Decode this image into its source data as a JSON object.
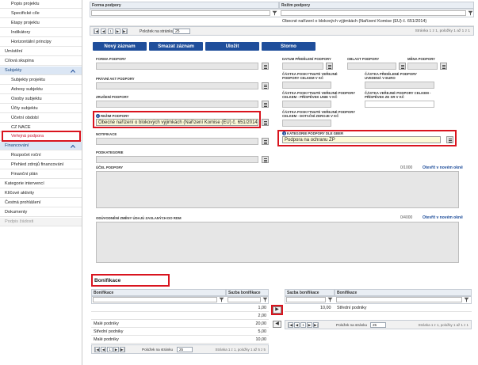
{
  "sidebar": {
    "items": [
      {
        "label": "Popis projektu",
        "level": 2
      },
      {
        "label": "Specifické cíle",
        "level": 2
      },
      {
        "label": "Etapy projektu",
        "level": 2
      },
      {
        "label": "Indikátory",
        "level": 2
      },
      {
        "label": "Horizontální principy",
        "level": 2
      },
      {
        "label": "Umístění",
        "level": 1
      },
      {
        "label": "Cílová skupina",
        "level": 1
      },
      {
        "label": "Subjekty",
        "level": 1
      },
      {
        "label": "Subjekty projektu",
        "level": 2
      },
      {
        "label": "Adresy subjektu",
        "level": 2
      },
      {
        "label": "Osoby subjektu",
        "level": 2
      },
      {
        "label": "Účty subjektu",
        "level": 2
      },
      {
        "label": "Účetní období",
        "level": 2
      },
      {
        "label": "CZ NACE",
        "level": 2
      },
      {
        "label": "Veřejná podpora",
        "level": 2
      },
      {
        "label": "Financování",
        "level": 1
      },
      {
        "label": "Rozpočet roční",
        "level": 2
      },
      {
        "label": "Přehled zdrojů financování",
        "level": 2
      },
      {
        "label": "Finanční plán",
        "level": 2
      },
      {
        "label": "Kategorie intervencí",
        "level": 1
      },
      {
        "label": "Klíčové aktivity",
        "level": 1
      },
      {
        "label": "Čestná prohlášení",
        "level": 1
      },
      {
        "label": "Dokumenty",
        "level": 1
      },
      {
        "label": "Podpis žádosti",
        "level": 1
      }
    ]
  },
  "top_grid": {
    "col1": "Forma podpory",
    "col2": "Režim podpory",
    "row_value": "Obecné nařízení o blokových výjimkách (Nařízení Komise (EU) č. 651/2014)",
    "pager": {
      "first": "|◀",
      "prev": "◀",
      "page": "1",
      "next": "▶",
      "last": "▶|",
      "per_page_label": "Položek na stránku",
      "per_page_value": "25",
      "info": "Stránka 1 z 1, položky 1 až 1 z 1"
    }
  },
  "actions": {
    "new": "Nový záznam",
    "delete": "Smazat záznam",
    "save": "Uložit",
    "cancel": "Storno"
  },
  "form": {
    "forma_podpory": "FORMA PODPORY",
    "pravni_akt": "PRÁVNÍ AKT PODPORY",
    "zruseni": "ZRUŠENÍ PODPORY",
    "rezim_label": "REŽIM PODPORY",
    "rezim_value": "Obecné nařízení o blokových výjimkách (Nařízení Komise (EU) č. 651/2014)",
    "notifikace": "NOTIFIKACE",
    "podkategorie": "PODKATEGORIE",
    "datum": "DATUM PŘIDĚLENÍ PODPORY",
    "oblast": "OBLAST PODPORY",
    "mena": "MĚNA PODPORY",
    "castka_kc": "ČÁSTKA POSKYTNUTÉ VEŘEJNÉ PODPORY CELKEM V KČ",
    "castka_eur": "ČÁSTKA PŘIDĚLENÉ PODPORY UVEDENÁ V EURO",
    "castka_eu": "ČÁSTKA POSKYTNUTÉ VEŘEJNÉ PODPORY CELKEM - PŘÍSPĚVEK UNIE V KČ",
    "castka_sr": "ČÁSTKA VEŘEJNÉ PODPORY CELKEM - PŘÍSPĚVEK ZE SR V KČ",
    "castka_nar": "ČÁSTKA POSKYTNUTÉ VEŘEJNÉ PODPORY CELKEM - DOTAČNÍ ZDROJE V KČ",
    "kategorie_label": "KATEGORIE PODPORY DLE GBER",
    "kategorie_value": "Podpora na ochranu ŽP",
    "ucel": "ÚČEL PODPORY",
    "ucel_counter": "0/1000",
    "ucel_link": "Otevřít v novém okně",
    "oduvodneni": "ODŮVODNĚNÍ ZMĚNY ÚDAJŮ ZASLANÝCH DO RDM",
    "oduvodneni_counter": "0/4000",
    "oduvodneni_link": "Otevřít v novém okně"
  },
  "bonifikace": {
    "title": "Bonifikace",
    "left": {
      "col1": "Bonifikace",
      "col2": "Sazba bonifikace",
      "rows": [
        {
          "name": "",
          "rate": "1,00"
        },
        {
          "name": "",
          "rate": "2,00"
        },
        {
          "name": "Malé podniky",
          "rate": "20,00"
        },
        {
          "name": "Střední podniky",
          "rate": "5,00"
        },
        {
          "name": "Malé podniky",
          "rate": "10,00"
        }
      ],
      "pager": {
        "page": "1",
        "per_page_label": "Položek na stránku",
        "per_page_value": "25",
        "info": "Stránka 1 z 1, položky 1 až 5 z 5"
      }
    },
    "right": {
      "col1": "Sazba bonifikace",
      "col2": "Bonifikace",
      "rows": [
        {
          "rate": "10,00",
          "name": "Střední podniky"
        }
      ],
      "pager": {
        "page": "1",
        "per_page_label": "Položek na stránku",
        "per_page_value": "25",
        "info": "Stránka 1 z 1, položky 1 až 1 z 1"
      }
    },
    "move_right": "▶",
    "move_left": "◀"
  }
}
